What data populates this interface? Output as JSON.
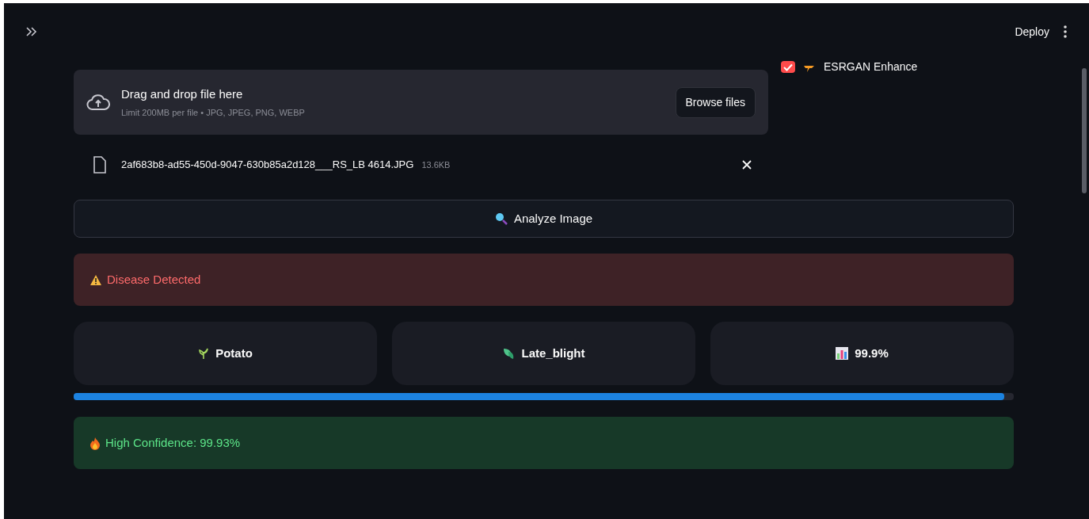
{
  "header": {
    "deploy": "Deploy"
  },
  "uploader": {
    "title": "Drag and drop file here",
    "limit": "Limit 200MB per file • JPG, JPEG, PNG, WEBP",
    "button": "Browse files"
  },
  "file": {
    "name": "2af683b8-ad55-450d-9047-630b85a2d128___RS_LB 4614.JPG",
    "size": "13.6KB"
  },
  "option": {
    "label": "ESRGAN Enhance",
    "checked": true
  },
  "analyze_button": "Analyze Image",
  "alerts": [
    {
      "kind": "error",
      "text": "Disease Detected"
    }
  ],
  "metrics": [
    {
      "kind": "plant",
      "text": "Potato"
    },
    {
      "kind": "leaf",
      "text": "Late_blight"
    },
    {
      "kind": "chart",
      "text": "99.9%"
    }
  ],
  "progress": {
    "level": 0.99
  },
  "result": {
    "kind": "success",
    "text": "High Confidence: 99.93%"
  }
}
